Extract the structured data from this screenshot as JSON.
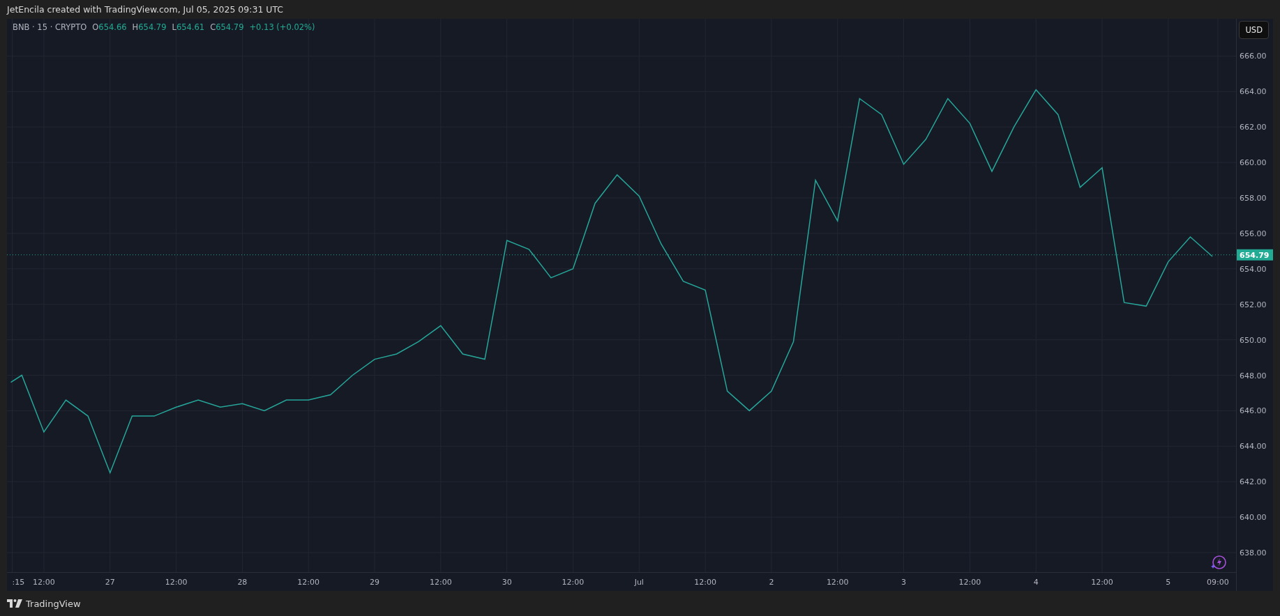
{
  "header": {
    "caption": "JetEncila created with TradingView.com, Jul 05, 2025 09:31 UTC"
  },
  "legend": {
    "ohlc": [
      {
        "label": "O",
        "value": "654.66"
      },
      {
        "label": "H",
        "value": "654.79"
      },
      {
        "label": "L",
        "value": "654.61"
      },
      {
        "label": "C",
        "value": "654.79"
      }
    ],
    "change": "+0.13 (+0.02%)"
  },
  "currency_button": "USD",
  "chart": {
    "chart_data": {
      "type": "line",
      "grid": true,
      "x": [
        "2025-06-26 06:00",
        "2025-06-26 08:00",
        "2025-06-26 12:00",
        "2025-06-26 16:00",
        "2025-06-26 20:00",
        "2025-06-27 00:00",
        "2025-06-27 04:00",
        "2025-06-27 08:00",
        "2025-06-27 12:00",
        "2025-06-27 16:00",
        "2025-06-27 20:00",
        "2025-06-28 00:00",
        "2025-06-28 04:00",
        "2025-06-28 08:00",
        "2025-06-28 12:00",
        "2025-06-28 16:00",
        "2025-06-28 20:00",
        "2025-06-29 00:00",
        "2025-06-29 04:00",
        "2025-06-29 08:00",
        "2025-06-29 12:00",
        "2025-06-29 16:00",
        "2025-06-29 20:00",
        "2025-06-30 00:00",
        "2025-06-30 04:00",
        "2025-06-30 08:00",
        "2025-06-30 12:00",
        "2025-06-30 16:00",
        "2025-06-30 20:00",
        "2025-07-01 00:00",
        "2025-07-01 04:00",
        "2025-07-01 08:00",
        "2025-07-01 12:00",
        "2025-07-01 16:00",
        "2025-07-01 20:00",
        "2025-07-02 00:00",
        "2025-07-02 04:00",
        "2025-07-02 08:00",
        "2025-07-02 12:00",
        "2025-07-02 16:00",
        "2025-07-02 20:00",
        "2025-07-03 00:00",
        "2025-07-03 04:00",
        "2025-07-03 08:00",
        "2025-07-03 12:00",
        "2025-07-03 16:00",
        "2025-07-03 20:00",
        "2025-07-04 00:00",
        "2025-07-04 04:00",
        "2025-07-04 08:00",
        "2025-07-04 12:00",
        "2025-07-04 16:00",
        "2025-07-04 20:00",
        "2025-07-05 00:00",
        "2025-07-05 04:00",
        "2025-07-05 08:00"
      ],
      "series": [
        {
          "name": "BNB · 15 · CRYPTO",
          "color": "#26a69a",
          "values": [
            647.6,
            648.0,
            644.8,
            646.6,
            645.7,
            642.5,
            645.7,
            645.7,
            646.2,
            646.6,
            646.2,
            646.4,
            646.0,
            646.6,
            646.6,
            646.9,
            648.0,
            648.9,
            649.2,
            649.9,
            650.8,
            649.2,
            648.9,
            655.6,
            655.1,
            653.5,
            654.0,
            657.7,
            659.3,
            658.1,
            655.4,
            653.3,
            652.8,
            647.1,
            646.0,
            647.1,
            649.9,
            659.0,
            656.7,
            663.6,
            662.7,
            659.9,
            661.3,
            663.6,
            662.2,
            659.5,
            662.0,
            664.1,
            662.7,
            658.6,
            659.7,
            652.1,
            651.9,
            654.4,
            655.8,
            654.7
          ]
        }
      ],
      "xlim": [
        "2025-06-26 05:18",
        "2025-07-05 12:18"
      ],
      "ylim": [
        636.9,
        668.1
      ],
      "xticks": [
        {
          "value": "2025-06-26 06:15",
          "label": ":15"
        },
        {
          "value": "2025-06-26 12:00",
          "label": "12:00"
        },
        {
          "value": "2025-06-27 00:00",
          "label": "27"
        },
        {
          "value": "2025-06-27 12:00",
          "label": "12:00"
        },
        {
          "value": "2025-06-28 00:00",
          "label": "28"
        },
        {
          "value": "2025-06-28 12:00",
          "label": "12:00"
        },
        {
          "value": "2025-06-29 00:00",
          "label": "29"
        },
        {
          "value": "2025-06-29 12:00",
          "label": "12:00"
        },
        {
          "value": "2025-06-30 00:00",
          "label": "30"
        },
        {
          "value": "2025-06-30 12:00",
          "label": "12:00"
        },
        {
          "value": "2025-07-01 00:00",
          "label": "Jul"
        },
        {
          "value": "2025-07-01 12:00",
          "label": "12:00"
        },
        {
          "value": "2025-07-02 00:00",
          "label": "2"
        },
        {
          "value": "2025-07-02 12:00",
          "label": "12:00"
        },
        {
          "value": "2025-07-03 00:00",
          "label": "3"
        },
        {
          "value": "2025-07-03 12:00",
          "label": "12:00"
        },
        {
          "value": "2025-07-04 00:00",
          "label": "4"
        },
        {
          "value": "2025-07-04 12:00",
          "label": "12:00"
        },
        {
          "value": "2025-07-05 00:00",
          "label": "5"
        },
        {
          "value": "2025-07-05 09:00",
          "label": "09:00"
        }
      ],
      "yticks": [
        {
          "value": 638,
          "label": "638.00"
        },
        {
          "value": 640,
          "label": "640.00"
        },
        {
          "value": 642,
          "label": "642.00"
        },
        {
          "value": 644,
          "label": "644.00"
        },
        {
          "value": 646,
          "label": "646.00"
        },
        {
          "value": 648,
          "label": "648.00"
        },
        {
          "value": 650,
          "label": "650.00"
        },
        {
          "value": 652,
          "label": "652.00"
        },
        {
          "value": 654,
          "label": "654.00"
        },
        {
          "value": 656,
          "label": "656.00"
        },
        {
          "value": 658,
          "label": "658.00"
        },
        {
          "value": 660,
          "label": "660.00"
        },
        {
          "value": 662,
          "label": "662.00"
        },
        {
          "value": 664,
          "label": "664.00"
        },
        {
          "value": 666,
          "label": "666.00"
        }
      ],
      "ref_lines": [
        {
          "axis": "y",
          "value": 654.79,
          "label": "654.79"
        }
      ]
    }
  },
  "footer": {
    "brand": "TradingView"
  }
}
